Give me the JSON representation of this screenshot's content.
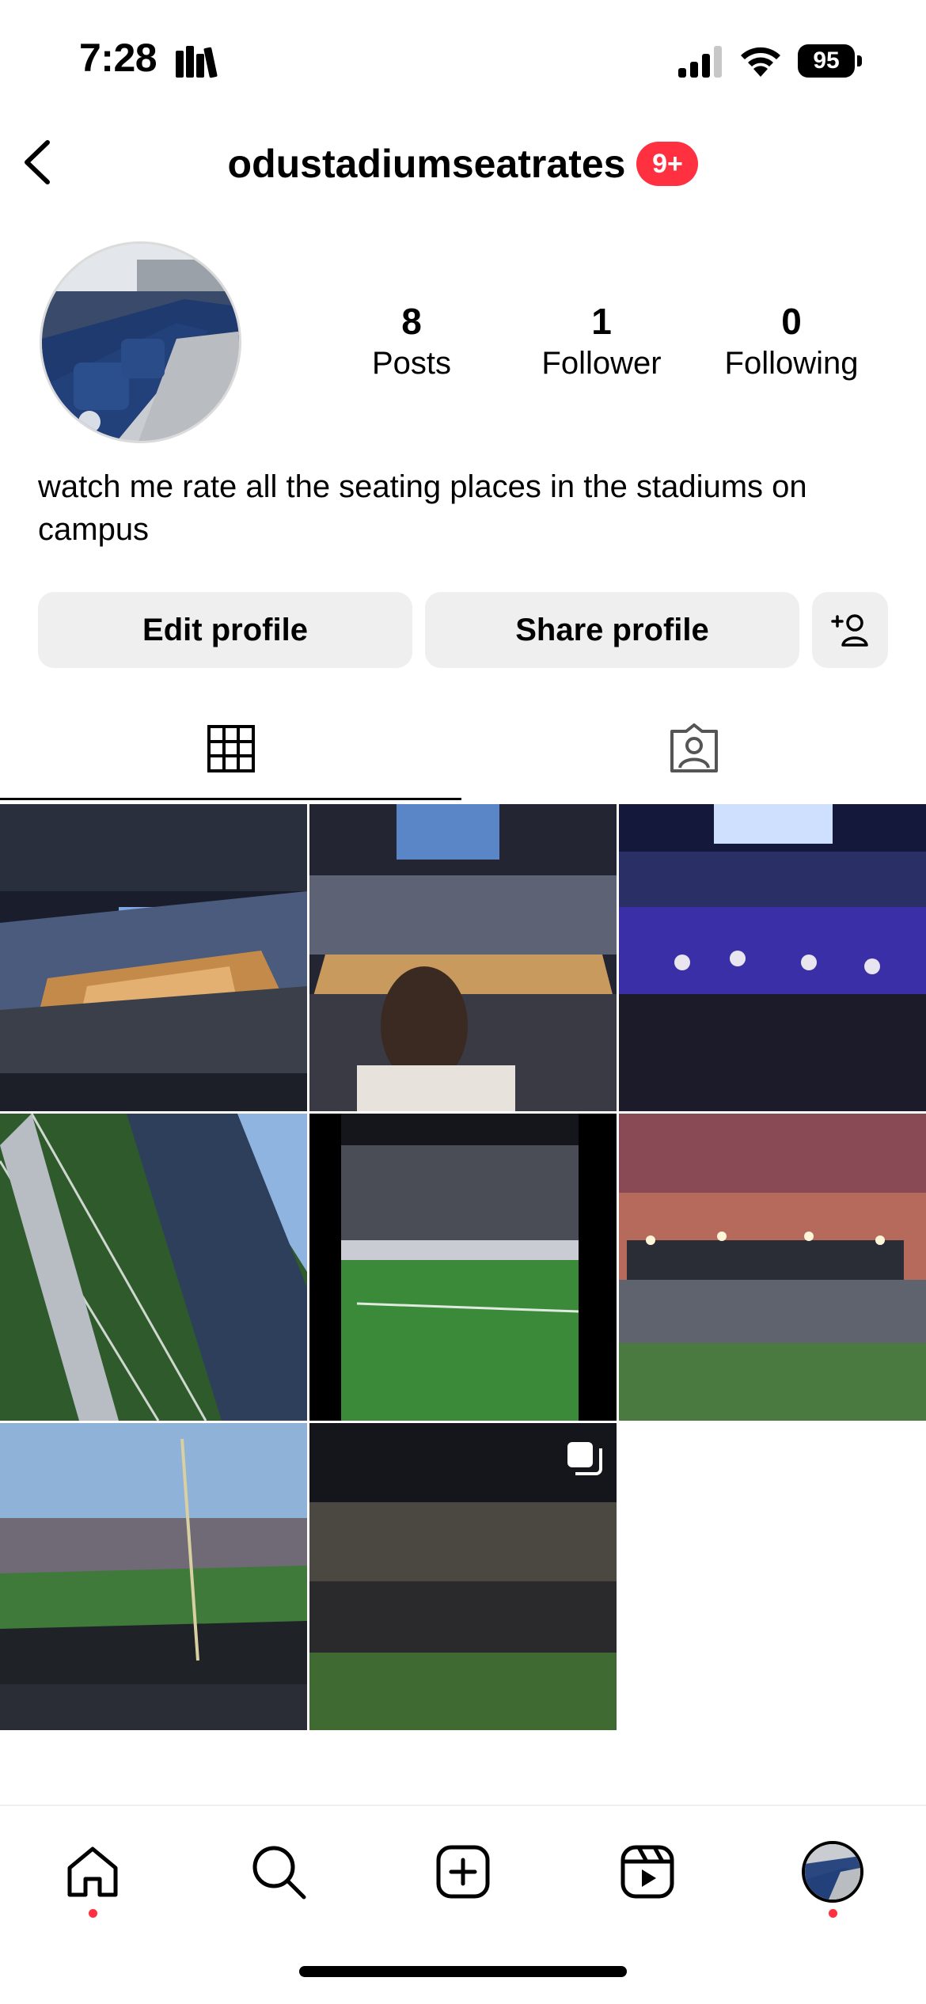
{
  "status_bar": {
    "time": "7:28",
    "battery": "95"
  },
  "header": {
    "username": "odustadiumseatrates",
    "notifications_badge": "9+"
  },
  "stats": [
    {
      "value": "8",
      "label": "Posts"
    },
    {
      "value": "1",
      "label": "Follower"
    },
    {
      "value": "0",
      "label": "Following"
    }
  ],
  "bio": "watch me rate all the seating places in the stadiums on campus",
  "buttons": {
    "edit_profile": "Edit profile",
    "share_profile": "Share profile"
  },
  "tabs": [
    {
      "icon": "grid-icon",
      "selected": true
    },
    {
      "icon": "tagged-icon",
      "selected": false
    }
  ],
  "posts": [
    {
      "scene": "arena-basketball-wide"
    },
    {
      "scene": "basketball-court-crowd"
    },
    {
      "scene": "arena-blue-lights"
    },
    {
      "scene": "football-field-tilted"
    },
    {
      "scene": "football-sideline-night"
    },
    {
      "scene": "stadium-sunset"
    },
    {
      "scene": "marching-band-field"
    },
    {
      "scene": "stadium-night-crowd",
      "multiple": true
    }
  ],
  "bottom_nav": [
    {
      "icon": "home-icon",
      "notification_dot": true
    },
    {
      "icon": "search-icon",
      "notification_dot": false
    },
    {
      "icon": "create-icon",
      "notification_dot": false
    },
    {
      "icon": "reels-icon",
      "notification_dot": false
    },
    {
      "icon": "profile-avatar",
      "notification_dot": true
    }
  ],
  "colors": {
    "badge_red": "#ff3040",
    "button_gray": "#efefef",
    "divider": "#dbdbdb"
  }
}
